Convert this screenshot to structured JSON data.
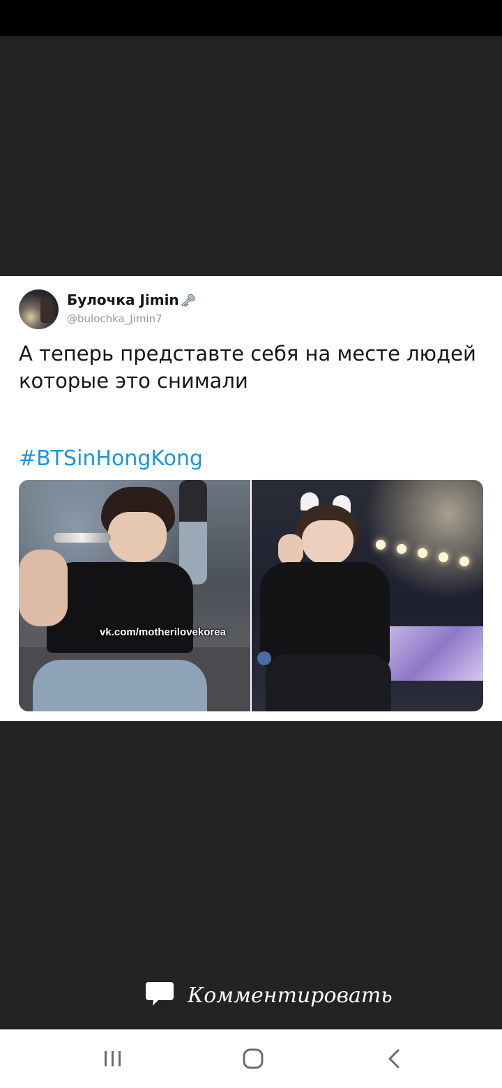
{
  "tweet": {
    "user_name": "Булочка Jimin",
    "user_handle": "@bulochka_Jimin7",
    "text_line_1": "А теперь представте себя на месте людей",
    "text_line_2": "которые это снимали",
    "hashtag": "#BTSinHongKong",
    "watermark": "vk.com/motherilovekorea",
    "name_icon": "key-icon"
  },
  "comment_bar": {
    "label": "Комментировать",
    "icon": "speech-bubble-icon"
  },
  "nav_bar": {
    "recents_icon": "recent-apps-icon",
    "home_icon": "home-icon",
    "back_icon": "back-icon"
  },
  "colors": {
    "background": "#232225",
    "hashtag": "#1b95e0",
    "card": "#ffffff"
  }
}
